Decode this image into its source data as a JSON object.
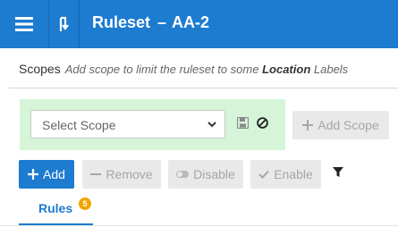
{
  "header": {
    "title": "Ruleset",
    "separator": "–",
    "ruleset_name": "AA-2"
  },
  "scopes": {
    "label": "Scopes",
    "hint_prefix": "Add scope to limit the ruleset to some ",
    "hint_bold": "Location",
    "hint_suffix": " Labels",
    "select_placeholder": "Select Scope",
    "add_scope_label": "Add Scope"
  },
  "toolbar": {
    "add_label": "Add",
    "remove_label": "Remove",
    "disable_label": "Disable",
    "enable_label": "Enable"
  },
  "tabs": [
    {
      "label": "Rules",
      "count": "5"
    }
  ],
  "colors": {
    "header_bg": "#1d7bd0",
    "scope_panel_bg": "#d6f5d8",
    "badge": "#f0a500"
  }
}
